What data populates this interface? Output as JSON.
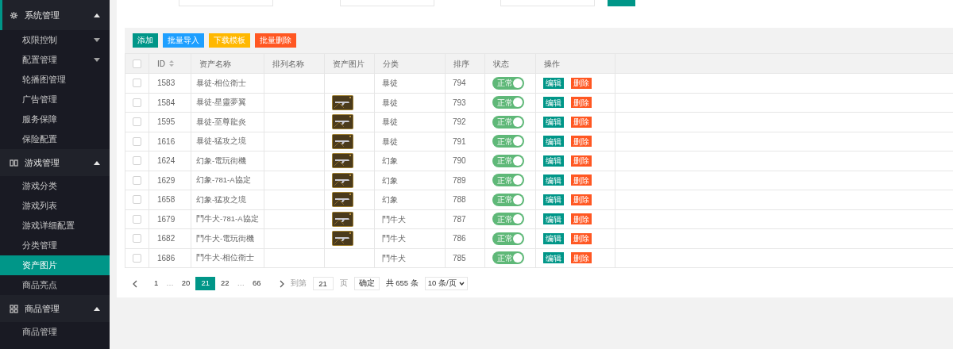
{
  "sidebar": {
    "groups": [
      {
        "label": "系统管理",
        "kind": "gear",
        "expanded": true,
        "items": [
          {
            "label": "权限控制",
            "has_children": true,
            "selected": false
          },
          {
            "label": "配置管理",
            "has_children": true,
            "selected": false
          },
          {
            "label": "轮播图管理",
            "has_children": false,
            "selected": false
          },
          {
            "label": "广告管理",
            "has_children": false,
            "selected": false
          },
          {
            "label": "服务保障",
            "has_children": false,
            "selected": false
          },
          {
            "label": "保险配置",
            "has_children": false,
            "selected": false
          }
        ]
      },
      {
        "label": "游戏管理",
        "kind": "columns",
        "expanded": true,
        "items": [
          {
            "label": "游戏分类",
            "has_children": false,
            "selected": false
          },
          {
            "label": "游戏列表",
            "has_children": false,
            "selected": false
          },
          {
            "label": "游戏详细配置",
            "has_children": false,
            "selected": false
          },
          {
            "label": "分类管理",
            "has_children": false,
            "selected": false
          },
          {
            "label": "资产图片",
            "has_children": false,
            "selected": true
          },
          {
            "label": "商品亮点",
            "has_children": false,
            "selected": false
          }
        ]
      },
      {
        "label": "商品管理",
        "kind": "apps",
        "expanded": true,
        "items": [
          {
            "label": "商品管理",
            "has_children": false,
            "selected": false
          }
        ]
      }
    ]
  },
  "toolbar": [
    {
      "label": "添加",
      "kind": "primary"
    },
    {
      "label": "批量导入",
      "kind": "info"
    },
    {
      "label": "下载模板",
      "kind": "warn"
    },
    {
      "label": "批量删除",
      "kind": "danger"
    }
  ],
  "table": {
    "all_checked": false,
    "columns": [
      "ID",
      "资产名称",
      "排列名称",
      "资产图片",
      "分类",
      "排序",
      "状态",
      "操作"
    ],
    "rows": [
      {
        "checked": false,
        "id": "1583",
        "name": "暴徒-相位衛士",
        "image": false,
        "category": "暴徒",
        "order": "794",
        "status": "正常",
        "on": true,
        "actions": [
          "编辑",
          "删除"
        ]
      },
      {
        "checked": false,
        "id": "1584",
        "name": "暴徒-星靈夢翼",
        "image": true,
        "category": "暴徒",
        "order": "793",
        "status": "正常",
        "on": true,
        "actions": [
          "编辑",
          "删除"
        ]
      },
      {
        "checked": false,
        "id": "1595",
        "name": "暴徒-至尊龍炎",
        "image": true,
        "category": "暴徒",
        "order": "792",
        "status": "正常",
        "on": true,
        "actions": [
          "编辑",
          "删除"
        ]
      },
      {
        "checked": false,
        "id": "1616",
        "name": "暴徒-猛攻之境",
        "image": true,
        "category": "暴徒",
        "order": "791",
        "status": "正常",
        "on": true,
        "actions": [
          "编辑",
          "删除"
        ]
      },
      {
        "checked": false,
        "id": "1624",
        "name": "幻象-電玩街機",
        "image": true,
        "category": "幻象",
        "order": "790",
        "status": "正常",
        "on": true,
        "actions": [
          "编辑",
          "删除"
        ]
      },
      {
        "checked": false,
        "id": "1629",
        "name": "幻象-781-A協定",
        "image": true,
        "category": "幻象",
        "order": "789",
        "status": "正常",
        "on": true,
        "actions": [
          "编辑",
          "删除"
        ]
      },
      {
        "checked": false,
        "id": "1658",
        "name": "幻象-猛攻之境",
        "image": true,
        "category": "幻象",
        "order": "788",
        "status": "正常",
        "on": true,
        "actions": [
          "编辑",
          "删除"
        ]
      },
      {
        "checked": false,
        "id": "1679",
        "name": "鬥牛犬-781-A協定",
        "image": true,
        "category": "鬥牛犬",
        "order": "787",
        "status": "正常",
        "on": true,
        "actions": [
          "编辑",
          "删除"
        ]
      },
      {
        "checked": false,
        "id": "1682",
        "name": "鬥牛犬-電玩街機",
        "image": true,
        "category": "鬥牛犬",
        "order": "786",
        "status": "正常",
        "on": true,
        "actions": [
          "编辑",
          "删除"
        ]
      },
      {
        "checked": false,
        "id": "1686",
        "name": "鬥牛犬-相位衛士",
        "image": false,
        "category": "鬥牛犬",
        "order": "785",
        "status": "正常",
        "on": true,
        "actions": [
          "编辑",
          "删除"
        ]
      }
    ]
  },
  "pagination": {
    "pages": [
      {
        "label": "1",
        "kind": "page",
        "selected": false
      },
      {
        "label": "…",
        "kind": "gap"
      },
      {
        "label": "20",
        "kind": "page",
        "selected": false
      },
      {
        "label": "21",
        "kind": "page",
        "selected": true
      },
      {
        "label": "22",
        "kind": "page",
        "selected": false
      },
      {
        "label": "…",
        "kind": "gap"
      },
      {
        "label": "66",
        "kind": "page",
        "selected": false
      }
    ],
    "goto_label": "到第",
    "goto_value": "21",
    "page_unit": "页",
    "confirm": "确定",
    "total": "共 655 条",
    "page_size": "10 条/页"
  }
}
